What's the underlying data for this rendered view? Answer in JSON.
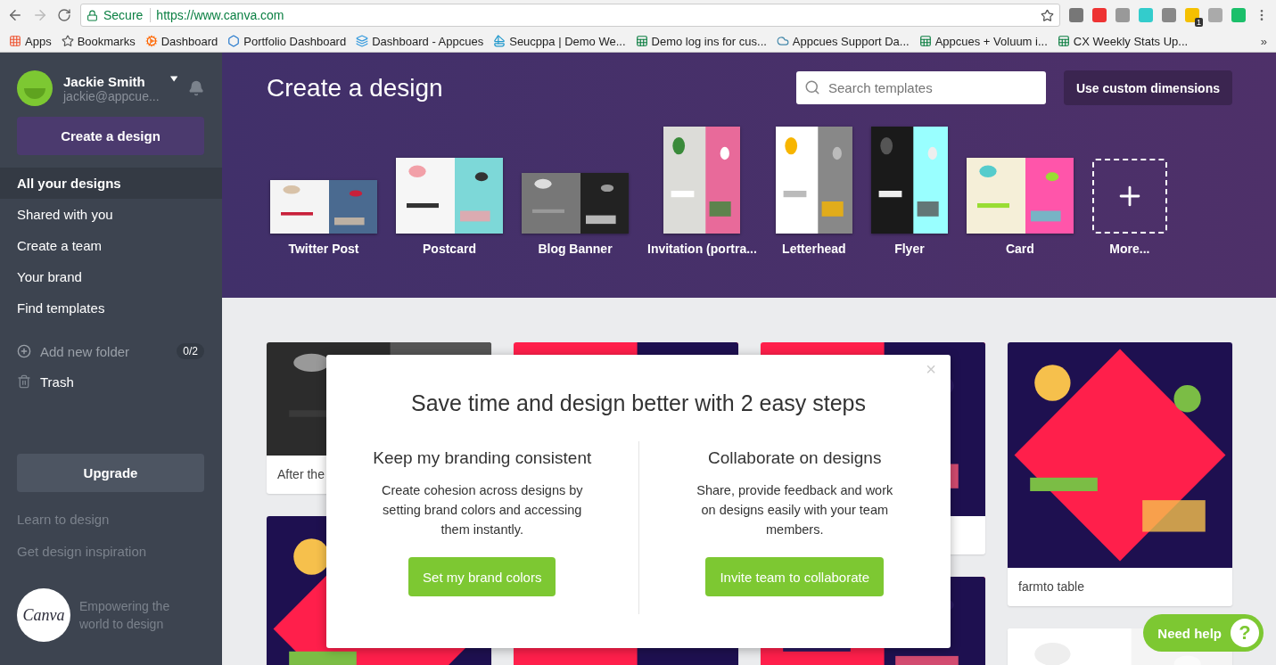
{
  "browser": {
    "secure_label": "Secure",
    "url": "https://www.canva.com",
    "extension_badge": "1",
    "bookmarks": [
      {
        "label": "Apps",
        "kind": "apps"
      },
      {
        "label": "Bookmarks",
        "kind": "star"
      },
      {
        "label": "Dashboard",
        "kind": "hub"
      },
      {
        "label": "Portfolio Dashboard",
        "kind": "diamond"
      },
      {
        "label": "Dashboard - Appcues",
        "kind": "stripes"
      },
      {
        "label": "Seucppa | Demo We...",
        "kind": "sail"
      },
      {
        "label": "Demo log ins for cus...",
        "kind": "sheet"
      },
      {
        "label": "Appcues Support Da...",
        "kind": "cloud"
      },
      {
        "label": "Appcues + Voluum i...",
        "kind": "sheet"
      },
      {
        "label": "CX Weekly Stats Up...",
        "kind": "sheet"
      }
    ],
    "overflow": "»"
  },
  "sidebar": {
    "user": {
      "name": "Jackie Smith",
      "email": "jackie@appcue..."
    },
    "create_button": "Create a design",
    "nav": [
      {
        "label": "All your designs",
        "selected": true
      },
      {
        "label": "Shared with you",
        "selected": false
      },
      {
        "label": "Create a team",
        "selected": false
      },
      {
        "label": "Your brand",
        "selected": false
      },
      {
        "label": "Find templates",
        "selected": false
      }
    ],
    "folder_action": {
      "label": "Add new folder",
      "count": "0/2"
    },
    "trash": "Trash",
    "upgrade": "Upgrade",
    "links": [
      "Learn to design",
      "Get design inspiration"
    ],
    "logo": {
      "text": "Canva",
      "tagline": "Empowering the world to design"
    }
  },
  "header": {
    "title": "Create a design",
    "search": {
      "placeholder": "Search templates"
    },
    "custom_button": "Use custom dimensions",
    "templates": [
      {
        "label": "Twitter Post",
        "kind": "banner"
      },
      {
        "label": "Postcard",
        "kind": "wide"
      },
      {
        "label": "Blog Banner",
        "kind": "strip"
      },
      {
        "label": "Invitation (portra...",
        "kind": "portrait"
      },
      {
        "label": "Letterhead",
        "kind": "portrait"
      },
      {
        "label": "Flyer",
        "kind": "portrait"
      },
      {
        "label": "Card",
        "kind": "wide"
      },
      {
        "label": "More...",
        "kind": "more"
      }
    ]
  },
  "designs": [
    [
      {
        "caption": "After the",
        "kind": "rose"
      },
      {
        "kind": "party"
      }
    ],
    [
      {
        "kind": "invite"
      },
      {
        "kind": "invite"
      }
    ],
    [
      {
        "kind": "invite"
      },
      {
        "kind": "ticket"
      }
    ],
    [
      {
        "caption": "farmto table",
        "kind": "party"
      },
      {
        "kind": "blank"
      }
    ]
  ],
  "modal": {
    "close": "×",
    "title": "Save time and design better with 2 easy steps",
    "options": [
      {
        "heading": "Keep my branding consistent",
        "body": "Create cohesion across designs by setting brand colors and accessing them instantly.",
        "button": "Set my brand colors"
      },
      {
        "heading": "Collaborate on designs",
        "body": "Share, provide feedback and work on designs easily with your team members.",
        "button": "Invite team to collaborate"
      }
    ]
  },
  "help": {
    "label": "Need help",
    "icon": "?"
  }
}
